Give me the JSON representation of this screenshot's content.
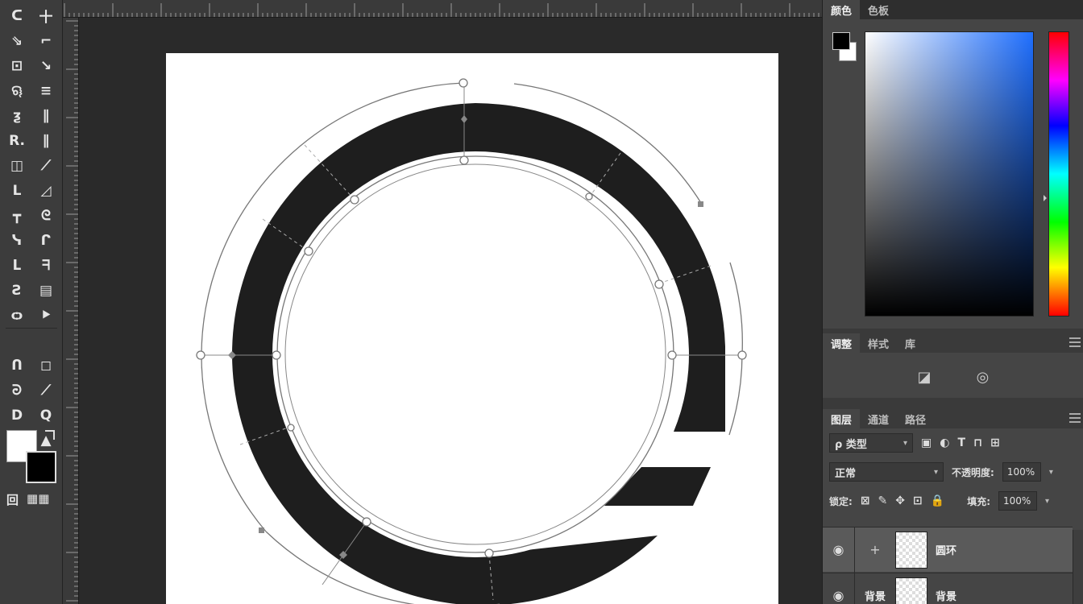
{
  "toolbox": {
    "tools": [
      {
        "name": "lasso-tool",
        "glyph": "ᑕ"
      },
      {
        "name": "move-tool",
        "glyph": "十"
      },
      {
        "name": "polygonal-lasso-tool",
        "glyph": "⇘"
      },
      {
        "name": "crop-tool",
        "glyph": "⌐"
      },
      {
        "name": "marquee-tool",
        "glyph": "⊡"
      },
      {
        "name": "slice-tool",
        "glyph": "↘"
      },
      {
        "name": "quick-select-tool",
        "glyph": "ୠ"
      },
      {
        "name": "eyedropper-tool",
        "glyph": "≡"
      },
      {
        "name": "spot-heal-tool",
        "glyph": "ƺ"
      },
      {
        "name": "ruler-tool",
        "glyph": "∥"
      },
      {
        "name": "brush-tool",
        "glyph": "R."
      },
      {
        "name": "pencil-tool",
        "glyph": "∥"
      },
      {
        "name": "clone-stamp-tool",
        "glyph": "◫"
      },
      {
        "name": "history-brush-tool",
        "glyph": "⟋"
      },
      {
        "name": "eraser-tool",
        "glyph": "L"
      },
      {
        "name": "bg-eraser-tool",
        "glyph": "◿"
      },
      {
        "name": "gradient-tool",
        "glyph": "┳"
      },
      {
        "name": "blur-tool",
        "glyph": "ᘓ"
      },
      {
        "name": "dodge-tool",
        "glyph": "ᓭ"
      },
      {
        "name": "burn-tool",
        "glyph": "ᒋ"
      },
      {
        "name": "pen-tool",
        "glyph": "ᒪ"
      },
      {
        "name": "freeform-pen-tool",
        "glyph": "ᖷ"
      },
      {
        "name": "type-tool",
        "glyph": "Ƨ"
      },
      {
        "name": "vertical-type-tool",
        "glyph": "▤"
      },
      {
        "name": "path-select-tool",
        "glyph": "ѻ"
      },
      {
        "name": "direct-select-tool",
        "glyph": "⯈"
      },
      {
        "name": "rectangle-tool",
        "glyph": "ᑎ"
      },
      {
        "name": "ellipse-tool",
        "glyph": "◻"
      },
      {
        "name": "hand-tool",
        "glyph": "ᘒ"
      },
      {
        "name": "rotate-view-tool",
        "glyph": "⟋"
      },
      {
        "name": "zoom-tool",
        "glyph": "D"
      },
      {
        "name": "zoom-out-tool",
        "glyph": "Q"
      },
      {
        "name": "edit-toolbar",
        "glyph": "ᒷ"
      },
      {
        "name": "extras-tool",
        "glyph": "▲"
      }
    ],
    "mode_left": "回",
    "mode_right": "▦▦"
  },
  "color_panel": {
    "tabs": [
      "颜色",
      "色板"
    ],
    "foreground": "#000000",
    "background": "#ffffff",
    "base_hue": "#1f6fff"
  },
  "adjust_panel": {
    "tabs": [
      "调整",
      "样式",
      "库"
    ],
    "icon1": "◪",
    "icon2": "◎"
  },
  "layers_panel": {
    "tabs": [
      "图层",
      "通道",
      "路径"
    ],
    "filter_label": "ρ 类型",
    "blend_mode": "正常",
    "opacity_label": "不透明度:",
    "opacity_value": "100%",
    "lock_label": "锁定:",
    "fill_label": "填充:",
    "fill_value": "100%",
    "filter_icons": [
      "▣",
      "◐",
      "T",
      "⊓",
      "⊞"
    ],
    "lock_icons": [
      "⊠",
      "✎",
      "✥",
      "⊡",
      "🔒"
    ],
    "layers": [
      {
        "name": "圆环",
        "active": true
      },
      {
        "name": "背景",
        "active": false,
        "tag": "背景"
      }
    ]
  }
}
